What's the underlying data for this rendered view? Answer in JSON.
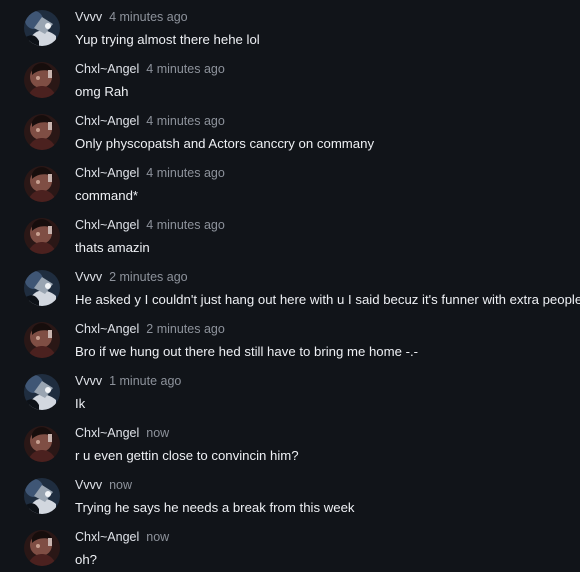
{
  "messages": [
    {
      "user": "Vvvv",
      "time": "4 minutes ago",
      "text": "Yup trying almost there hehe lol",
      "avatar": "vvvv-avatar"
    },
    {
      "user": "Chxl~Angel",
      "time": "4 minutes ago",
      "text": "omg Rah",
      "avatar": "angel-avatar"
    },
    {
      "user": "Chxl~Angel",
      "time": "4 minutes ago",
      "text": "Only physcopatsh and Actors canccry on commany",
      "avatar": "angel-avatar"
    },
    {
      "user": "Chxl~Angel",
      "time": "4 minutes ago",
      "text": "command*",
      "avatar": "angel-avatar"
    },
    {
      "user": "Chxl~Angel",
      "time": "4 minutes ago",
      "text": "thats amazin",
      "avatar": "angel-avatar"
    },
    {
      "user": "Vvvv",
      "time": "2 minutes ago",
      "text": "He asked y I couldn't just hang out here with u I said becuz it's funner with extra people",
      "avatar": "vvvv-avatar"
    },
    {
      "user": "Chxl~Angel",
      "time": "2 minutes ago",
      "text": "Bro if we hung out there hed still have to bring me home -.-",
      "avatar": "angel-avatar"
    },
    {
      "user": "Vvvv",
      "time": "1 minute ago",
      "text": "Ik",
      "avatar": "vvvv-avatar"
    },
    {
      "user": "Chxl~Angel",
      "time": "now",
      "text": "r u even gettin close to convincin him?",
      "avatar": "angel-avatar"
    },
    {
      "user": "Vvvv",
      "time": "now",
      "text": "Trying he says he needs a break from this week",
      "avatar": "vvvv-avatar"
    },
    {
      "user": "Chxl~Angel",
      "time": "now",
      "text": "oh?",
      "avatar": "angel-avatar"
    }
  ],
  "colors": {
    "background": "#111419",
    "username": "#dfe2e8",
    "timestamp": "#8d929b",
    "message_text": "#eef0f4"
  }
}
